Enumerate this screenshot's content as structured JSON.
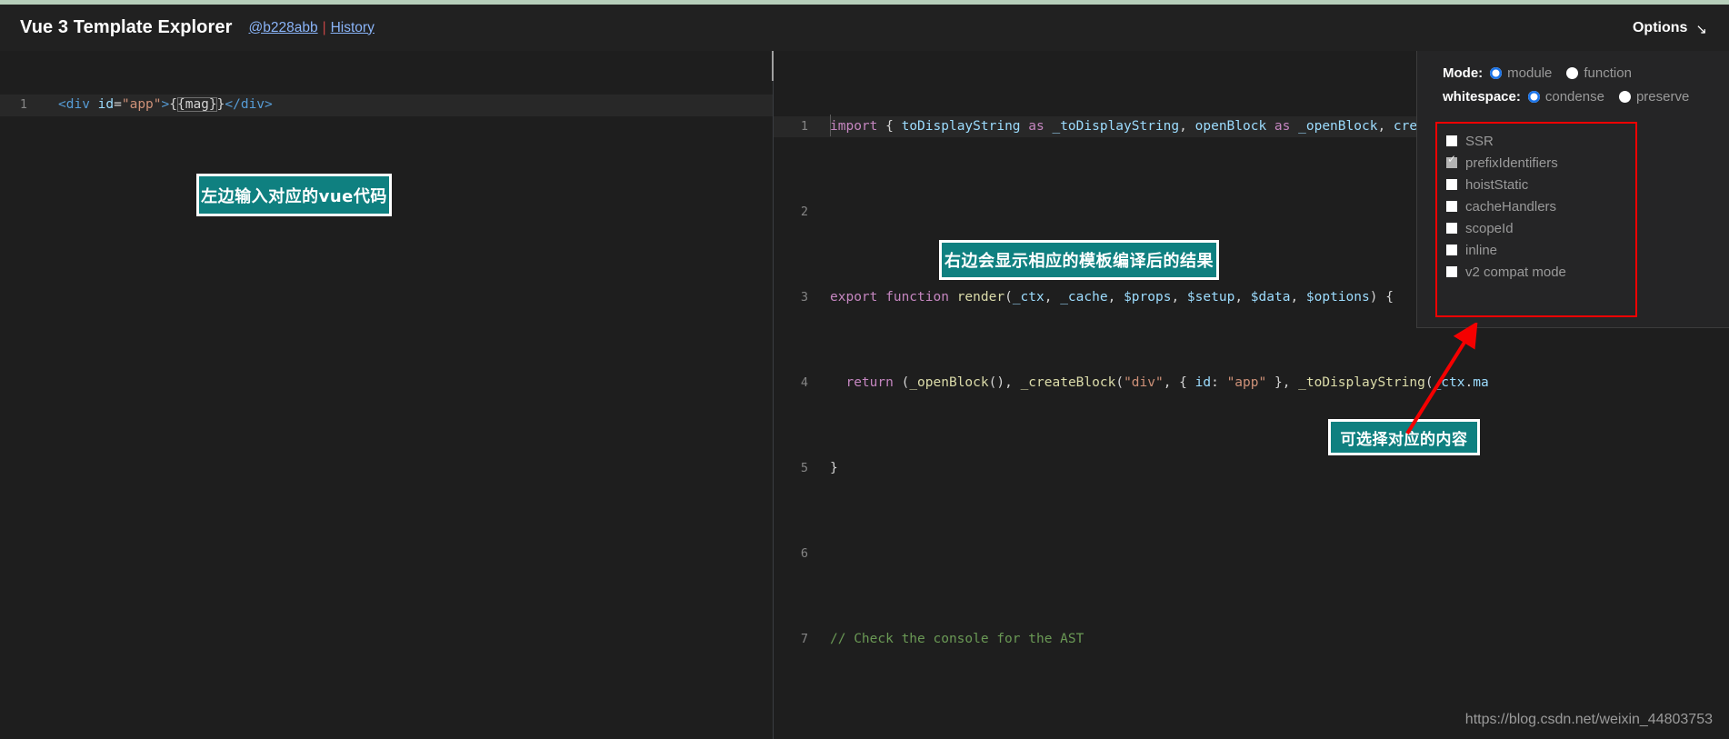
{
  "header": {
    "title": "Vue 3 Template Explorer",
    "commit_link": "@b228abb",
    "separator": "|",
    "history_link": "History",
    "options_label": "Options",
    "options_arrow": "↘"
  },
  "left_editor": {
    "name": "template-source-editor",
    "lines": [
      {
        "number": "1",
        "text": "<div id=\"app\">{{mag}}</div>",
        "tokens": [
          {
            "t": "<div",
            "c": "t-tag"
          },
          {
            "t": " ",
            "c": "t-def"
          },
          {
            "t": "id",
            "c": "t-attr"
          },
          {
            "t": "=",
            "c": "t-def"
          },
          {
            "t": "\"app\"",
            "c": "t-str"
          },
          {
            "t": ">",
            "c": "t-tag"
          },
          {
            "t": "{{mag}}",
            "c": "t-mus"
          },
          {
            "t": "</div>",
            "c": "t-tag"
          }
        ]
      }
    ]
  },
  "right_editor": {
    "name": "compiled-output-editor",
    "lines": [
      {
        "number": "1",
        "text": "import { toDisplayString as _toDisplayString, openBlock as _openBlock, createBlock"
      },
      {
        "number": "2",
        "text": ""
      },
      {
        "number": "3",
        "text": "export function render(_ctx, _cache, $props, $setup, $data, $options) {"
      },
      {
        "number": "4",
        "text": "  return (_openBlock(), _createBlock(\"div\", { id: \"app\" }, _toDisplayString(_ctx.ma"
      },
      {
        "number": "5",
        "text": "}"
      },
      {
        "number": "6",
        "text": ""
      },
      {
        "number": "7",
        "text": "// Check the console for the AST"
      }
    ]
  },
  "options": {
    "mode": {
      "label": "Mode:",
      "choices": [
        {
          "label": "module",
          "selected": true
        },
        {
          "label": "function",
          "selected": false
        }
      ]
    },
    "whitespace": {
      "label": "whitespace:",
      "choices": [
        {
          "label": "condense",
          "selected": true
        },
        {
          "label": "preserve",
          "selected": false
        }
      ]
    },
    "checkboxes": [
      {
        "label": "SSR",
        "checked": false
      },
      {
        "label": "prefixIdentifiers",
        "checked": true
      },
      {
        "label": "hoistStatic",
        "checked": false
      },
      {
        "label": "cacheHandlers",
        "checked": false
      },
      {
        "label": "scopeId",
        "checked": false
      },
      {
        "label": "inline",
        "checked": false
      },
      {
        "label": "v2 compat mode",
        "checked": false
      }
    ],
    "highlight_color": "#f50000"
  },
  "annotations": [
    {
      "text": "左边输入对应的vue代码"
    },
    {
      "text": "右边会显示相应的模板编译后的结果"
    },
    {
      "text": "可选择对应的内容"
    }
  ],
  "watermark": "https://blog.csdn.net/weixin_44803753",
  "colors": {
    "accent_teal": "#0f8080",
    "highlight_red": "#f50000",
    "link_blue": "#8ab4f8",
    "radio_blue": "#1a73e8",
    "top_strip": "#b7cfbb"
  }
}
